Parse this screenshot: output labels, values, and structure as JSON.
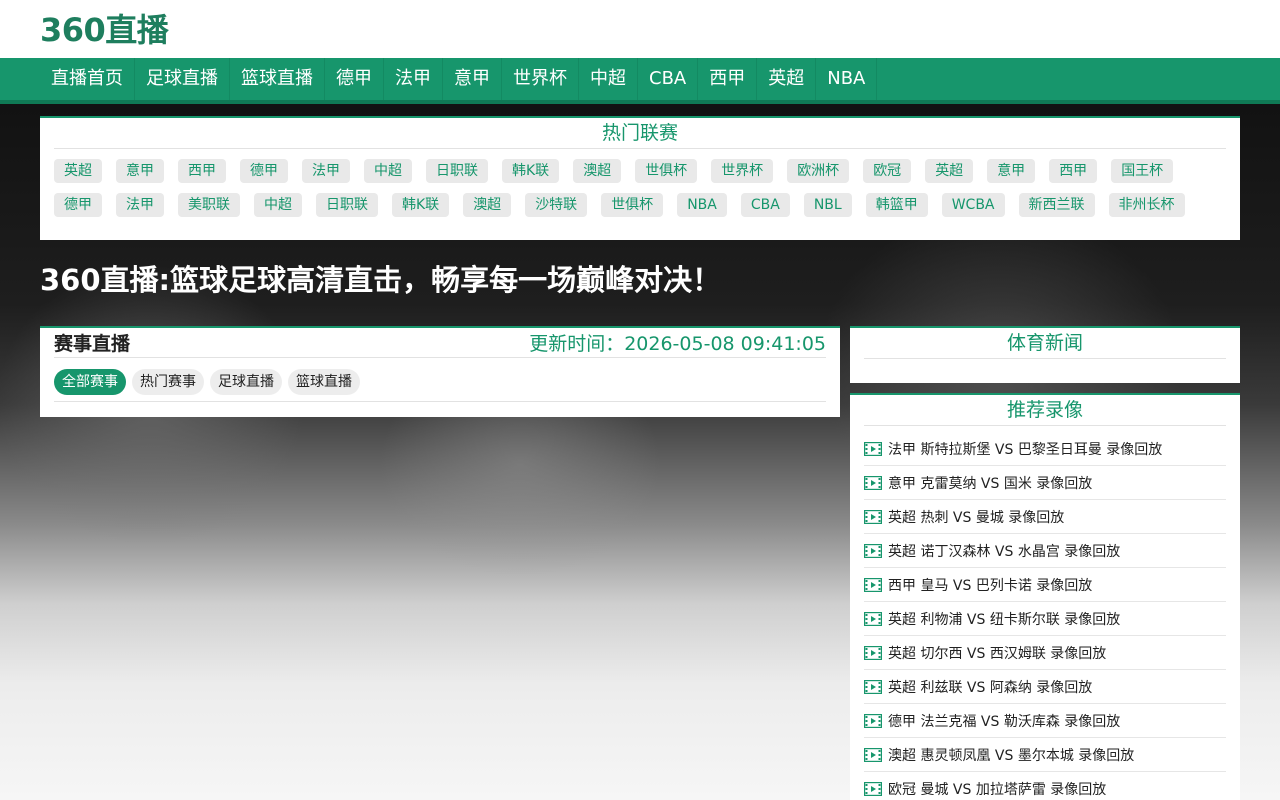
{
  "site": {
    "logo": "360直播"
  },
  "nav": {
    "items": [
      "直播首页",
      "足球直播",
      "篮球直播",
      "德甲",
      "法甲",
      "意甲",
      "世界杯",
      "中超",
      "CBA",
      "西甲",
      "英超",
      "NBA"
    ]
  },
  "hot_leagues": {
    "title": "热门联赛",
    "row1": [
      "英超",
      "意甲",
      "西甲",
      "德甲",
      "法甲",
      "中超",
      "日职联",
      "韩K联",
      "澳超",
      "世俱杯",
      "世界杯",
      "欧洲杯",
      "欧冠",
      "英超",
      "意甲",
      "西甲",
      "国王杯"
    ],
    "row2": [
      "德甲",
      "法甲",
      "美职联",
      "中超",
      "日职联",
      "韩K联",
      "澳超",
      "沙特联",
      "世俱杯",
      "NBA",
      "CBA",
      "NBL",
      "韩篮甲",
      "WCBA",
      "新西兰联",
      "非州长杯"
    ]
  },
  "headline": "360直播:篮球足球高清直击，畅享每一场巅峰对决！",
  "live": {
    "title": "赛事直播",
    "update_time": "更新时间：2026-05-08 09:41:05",
    "filters": [
      "全部赛事",
      "热门赛事",
      "足球直播",
      "篮球直播"
    ],
    "active_filter": "全部赛事"
  },
  "news": {
    "title": "体育新闻"
  },
  "recommended": {
    "title": "推荐录像",
    "icon": "film-icon",
    "accent_color": "#17966c",
    "items": [
      "法甲 斯特拉斯堡 VS 巴黎圣日耳曼 录像回放",
      "意甲 克雷莫纳 VS 国米 录像回放",
      "英超 热刺 VS 曼城 录像回放",
      "英超 诺丁汉森林 VS 水晶宫 录像回放",
      "西甲 皇马 VS 巴列卡诺 录像回放",
      "英超 利物浦 VS 纽卡斯尔联 录像回放",
      "英超 切尔西 VS 西汉姆联 录像回放",
      "英超 利兹联 VS 阿森纳 录像回放",
      "德甲 法兰克福 VS 勒沃库森 录像回放",
      "澳超 惠灵顿凤凰 VS 墨尔本城 录像回放",
      "欧冠 曼城 VS 加拉塔萨雷 录像回放"
    ]
  }
}
